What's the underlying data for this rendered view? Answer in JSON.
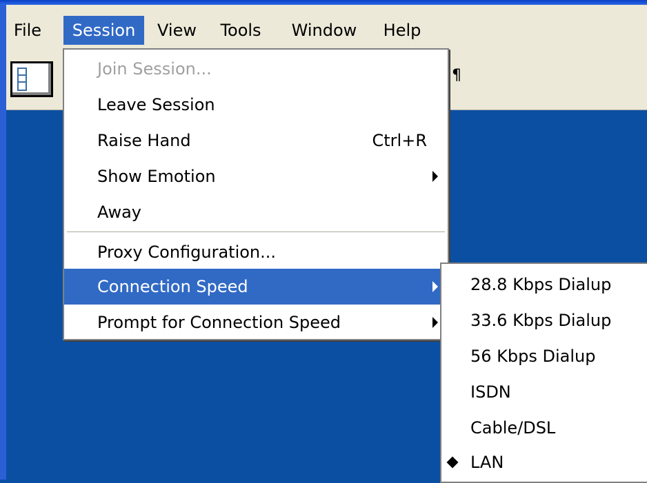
{
  "menubar": {
    "items": [
      {
        "label": "File"
      },
      {
        "label": "Session"
      },
      {
        "label": "View"
      },
      {
        "label": "Tools"
      },
      {
        "label": "Window"
      },
      {
        "label": "Help"
      }
    ]
  },
  "toolbar": {
    "partial_glyph": "¶"
  },
  "session_menu": {
    "items": [
      {
        "label": "Join Session...",
        "state": "disabled"
      },
      {
        "label": "Leave Session"
      },
      {
        "label": "Raise Hand",
        "shortcut": "Ctrl+R"
      },
      {
        "label": "Show Emotion",
        "submenu_arrow": "chevron-right-icon"
      },
      {
        "label": "Away"
      },
      {
        "label": "Proxy Configuration..."
      },
      {
        "label": "Connection Speed",
        "submenu_arrow": "chevron-right-icon",
        "state": "highlighted"
      },
      {
        "label": "Prompt for Connection Speed",
        "submenu_arrow": "chevron-right-icon"
      }
    ]
  },
  "connection_speed_submenu": {
    "items": [
      {
        "label": "28.8 Kbps Dialup"
      },
      {
        "label": "33.6 Kbps Dialup"
      },
      {
        "label": "56 Kbps Dialup"
      },
      {
        "label": "ISDN"
      },
      {
        "label": "Cable/DSL"
      },
      {
        "label": "LAN",
        "selected": true
      }
    ]
  },
  "colors": {
    "desktop_background": "#0b4fa3",
    "menu_highlight": "#316ac5",
    "menubar_background": "#ece9d8",
    "disabled_text": "#a0a0a0"
  }
}
